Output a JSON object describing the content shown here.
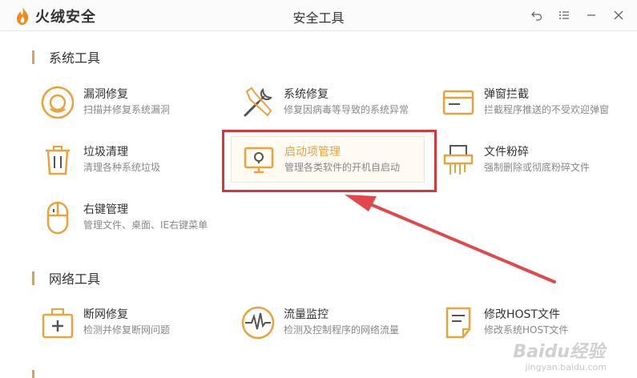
{
  "app": {
    "brand": "火绒安全",
    "window_title": "安全工具"
  },
  "sections": [
    {
      "title": "系统工具"
    },
    {
      "title": "网络工具"
    }
  ],
  "system_tools": [
    {
      "name": "漏洞修复",
      "desc": "扫描并修复系统漏洞",
      "icon": "bug-fix-icon"
    },
    {
      "name": "系统修复",
      "desc": "修复因病毒等导致的系统异常",
      "icon": "tools-icon"
    },
    {
      "name": "弹窗拦截",
      "desc": "拦截程序推送的不受欢迎弹窗",
      "icon": "popup-window-icon"
    },
    {
      "name": "垃圾清理",
      "desc": "清理各种系统垃圾",
      "icon": "trash-icon"
    },
    {
      "name": "启动项管理",
      "desc": "管理各类软件的开机自启动",
      "icon": "monitor-icon"
    },
    {
      "name": "文件粉碎",
      "desc": "强制删除或彻底粉碎文件",
      "icon": "shredder-icon"
    },
    {
      "name": "右键管理",
      "desc": "管理文件、桌面、IE右键菜单",
      "icon": "mouse-icon"
    }
  ],
  "network_tools": [
    {
      "name": "断网修复",
      "desc": "检测并修复断网问题",
      "icon": "first-aid-icon"
    },
    {
      "name": "流量监控",
      "desc": "检测及控制程序的网络流量",
      "icon": "traffic-wave-icon"
    },
    {
      "name": "修改HOST文件",
      "desc": "修改系统HOST文件",
      "icon": "host-file-icon"
    }
  ],
  "watermark": {
    "text": "Baidu经验",
    "url": "jingyan.baidu.com"
  },
  "colors": {
    "accent": "#e8a33b",
    "highlight": "#d9363c"
  }
}
